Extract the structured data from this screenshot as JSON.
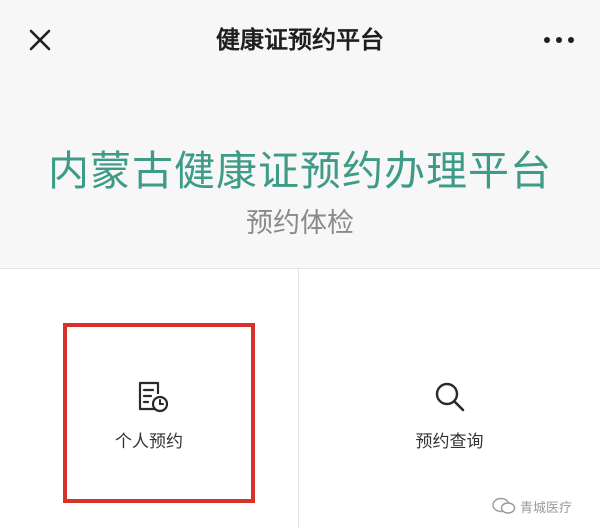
{
  "nav": {
    "title": "健康证预约平台"
  },
  "header": {
    "platform_title": "内蒙古健康证预约办理平台",
    "subtitle": "预约体检"
  },
  "grid": {
    "items": [
      {
        "label": "个人预约",
        "icon": "document-clock-icon"
      },
      {
        "label": "预约查询",
        "icon": "search-icon"
      }
    ]
  },
  "highlight_color": "#d6322b",
  "accent_color": "#3d9b87",
  "watermark": {
    "text": "青城医疗"
  }
}
